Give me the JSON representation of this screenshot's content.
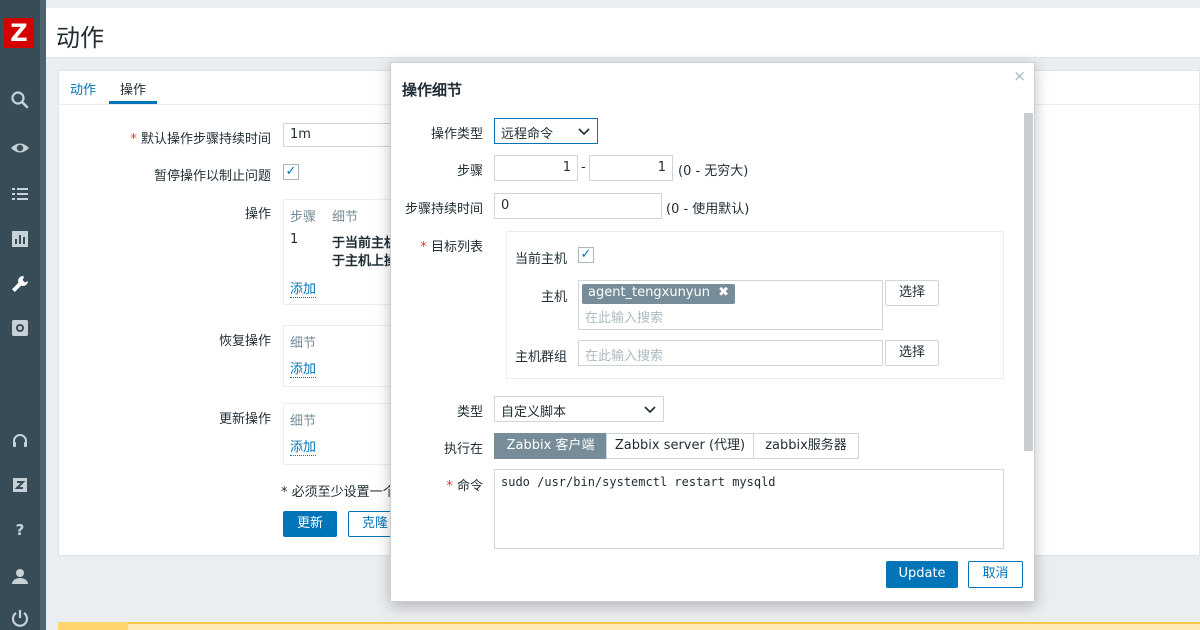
{
  "sidebar": {
    "logo": "Z",
    "items": [
      {
        "icon": "search-icon"
      },
      {
        "icon": "eye-icon"
      },
      {
        "icon": "list-icon"
      },
      {
        "icon": "chart-icon"
      },
      {
        "icon": "wrench-icon"
      },
      {
        "icon": "gear-icon"
      },
      {
        "icon": "headset-icon"
      },
      {
        "icon": "zabbix-icon"
      },
      {
        "icon": "help-icon"
      },
      {
        "icon": "user-icon"
      },
      {
        "icon": "power-icon"
      }
    ]
  },
  "page": {
    "title": "动作",
    "tabs": [
      {
        "label": "动作"
      },
      {
        "label": "操作"
      }
    ]
  },
  "form": {
    "default_duration_label": "默认操作步骤持续时间",
    "default_duration_value": "1m",
    "pause_label": "暂停操作以制止问题",
    "pause_checked": "✓",
    "operations_label": "操作",
    "ops_headers": [
      "步骤",
      "细节"
    ],
    "ops_row_step": "1",
    "ops_row_detail_1": "于当前主机",
    "ops_row_detail_2": "于主机上操",
    "recovery_label": "恢复操作",
    "update_ops_label": "更新操作",
    "detail_header": "细节",
    "add_link": "添加",
    "required_note": "* 必须至少设置一个",
    "update_button": "更新",
    "clone_button": "克隆"
  },
  "dialog": {
    "title": "操作细节",
    "close": "×",
    "op_type_label": "操作类型",
    "op_type_value": "远程命令",
    "steps_label": "步骤",
    "step_from": "1",
    "step_sep": "-",
    "step_to": "1",
    "steps_hint": "(0 - 无穷大)",
    "step_duration_label": "步骤持续时间",
    "step_duration_value": "0",
    "step_duration_hint": "(0 - 使用默认)",
    "target_list_label": "目标列表",
    "current_host_label": "当前主机",
    "current_host_checked": "✓",
    "host_label": "主机",
    "host_tag": "agent_tengxunyun",
    "tag_remove": "✖",
    "search_placeholder": "在此输入搜索",
    "select_button": "选择",
    "host_group_label": "主机群组",
    "type_label": "类型",
    "type_value": "自定义脚本",
    "execute_on_label": "执行在",
    "execute_on_options": [
      "Zabbix 客户端",
      "Zabbix server (代理)",
      "zabbix服务器"
    ],
    "execute_on_selected": "Zabbix 客户端",
    "command_label": "命令",
    "command_value": "sudo /usr/bin/systemctl restart mysqld",
    "update_button": "Update",
    "cancel_button": "取消"
  },
  "colors": {
    "sidebar": "#384c58",
    "accent": "#0275b8",
    "required": "#e33734",
    "logo": "#d40000"
  }
}
